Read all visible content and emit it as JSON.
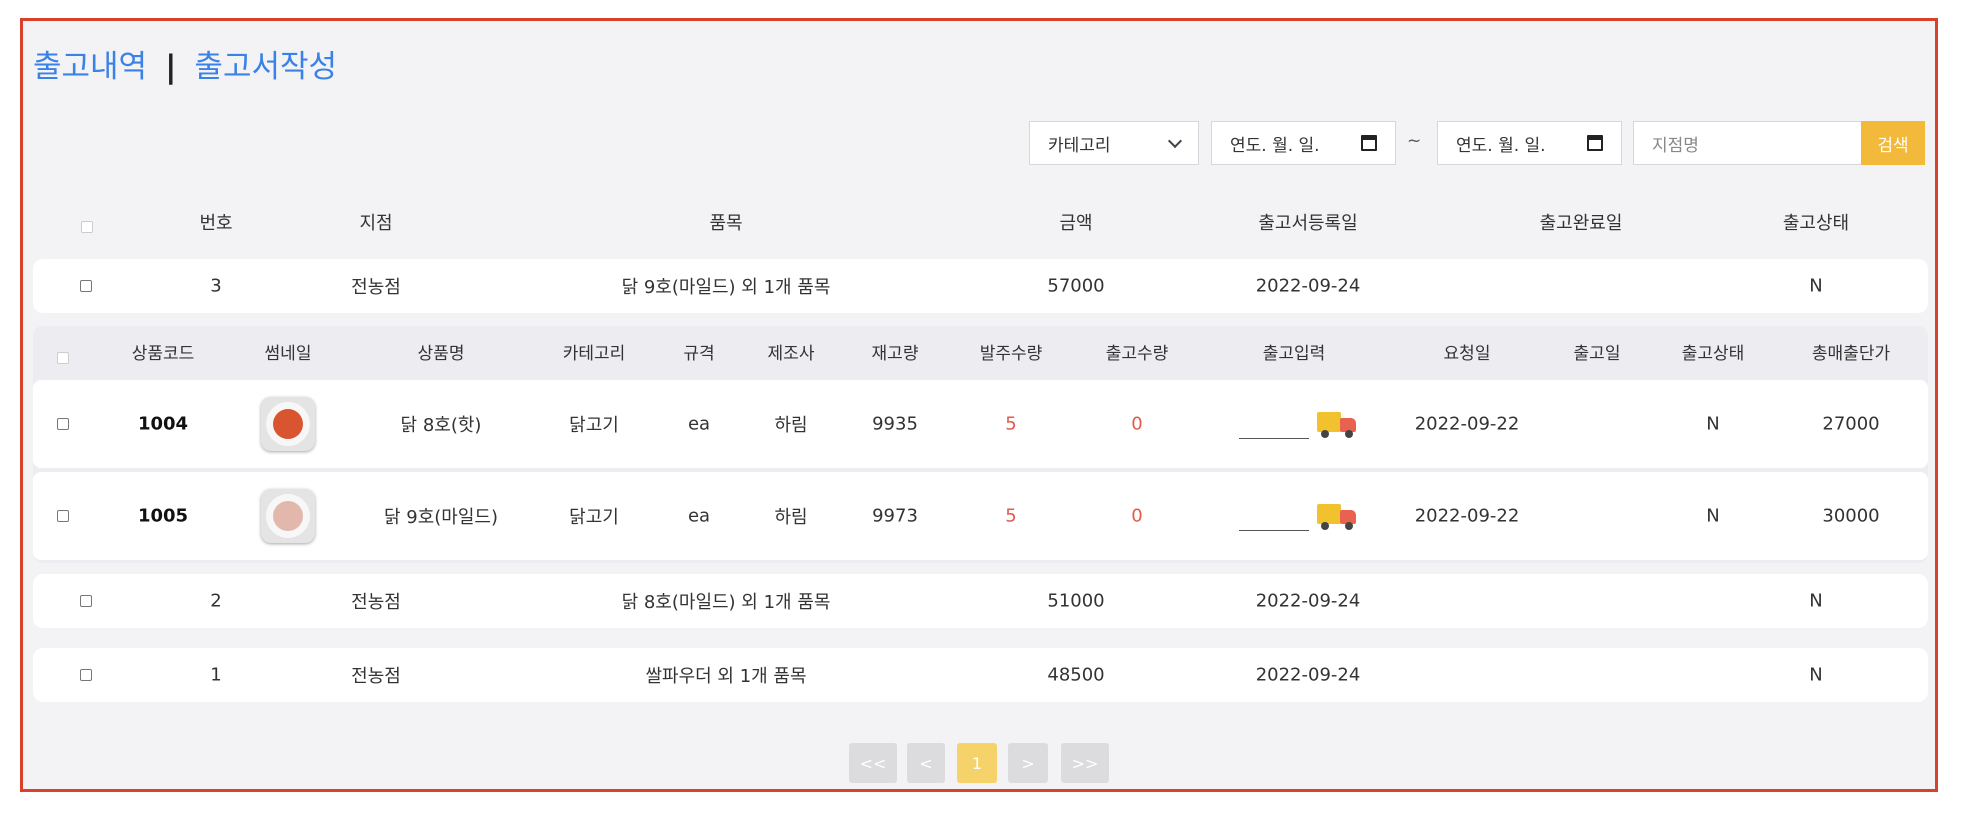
{
  "header": {
    "tab_history": "출고내역",
    "separator": "|",
    "tab_write": "출고서작성"
  },
  "filters": {
    "category_selected": "카테고리",
    "date_start": "연도. 월. 일.",
    "tilde": "~",
    "date_end": "연도. 월. 일.",
    "branch_placeholder": "지점명",
    "search_label": "검색",
    "search_color": "#f3b93b"
  },
  "table": {
    "columns": [
      "번호",
      "지점",
      "품목",
      "금액",
      "출고서등록일",
      "출고완료일",
      "출고상태"
    ],
    "rows": [
      {
        "no": "3",
        "branch": "전농점",
        "items": "닭 9호(마일드) 외 1개 품목",
        "amount": "57000",
        "reg_date": "2022-09-24",
        "done_date": "",
        "status": "N"
      },
      {
        "no": "2",
        "branch": "전농점",
        "items": "닭 8호(마일드) 외 1개 품목",
        "amount": "51000",
        "reg_date": "2022-09-24",
        "done_date": "",
        "status": "N"
      },
      {
        "no": "1",
        "branch": "전농점",
        "items": "쌀파우더 외 1개 품목",
        "amount": "48500",
        "reg_date": "2022-09-24",
        "done_date": "",
        "status": "N"
      }
    ]
  },
  "detail": {
    "columns": [
      "상품코드",
      "썸네일",
      "상품명",
      "카테고리",
      "규격",
      "제조사",
      "재고량",
      "발주수량",
      "출고수량",
      "출고입력",
      "요청일",
      "출고일",
      "출고상태",
      "총매출단가"
    ],
    "rows": [
      {
        "code": "1004",
        "name": "닭 8호(핫)",
        "category": "닭고기",
        "spec": "ea",
        "maker": "하림",
        "stock": "9935",
        "order_qty": "5",
        "ship_qty": "0",
        "ship_input": "",
        "ship_icon": "delivery-truck-icon",
        "req_date": "2022-09-22",
        "ship_date": "",
        "status": "N",
        "total": "27000"
      },
      {
        "code": "1005",
        "name": "닭 9호(마일드)",
        "category": "닭고기",
        "spec": "ea",
        "maker": "하림",
        "stock": "9973",
        "order_qty": "5",
        "ship_qty": "0",
        "ship_input": "",
        "ship_icon": "delivery-truck-icon",
        "req_date": "2022-09-22",
        "ship_date": "",
        "status": "N",
        "total": "30000"
      }
    ]
  },
  "pagination": {
    "first": "<<",
    "prev": "<",
    "current": "1",
    "next": ">",
    "last": ">>"
  },
  "colors": {
    "frame_border": "#d9412b",
    "link": "#3b82e6",
    "qty_red": "#e35a4b",
    "page_active": "#f6d26a"
  }
}
